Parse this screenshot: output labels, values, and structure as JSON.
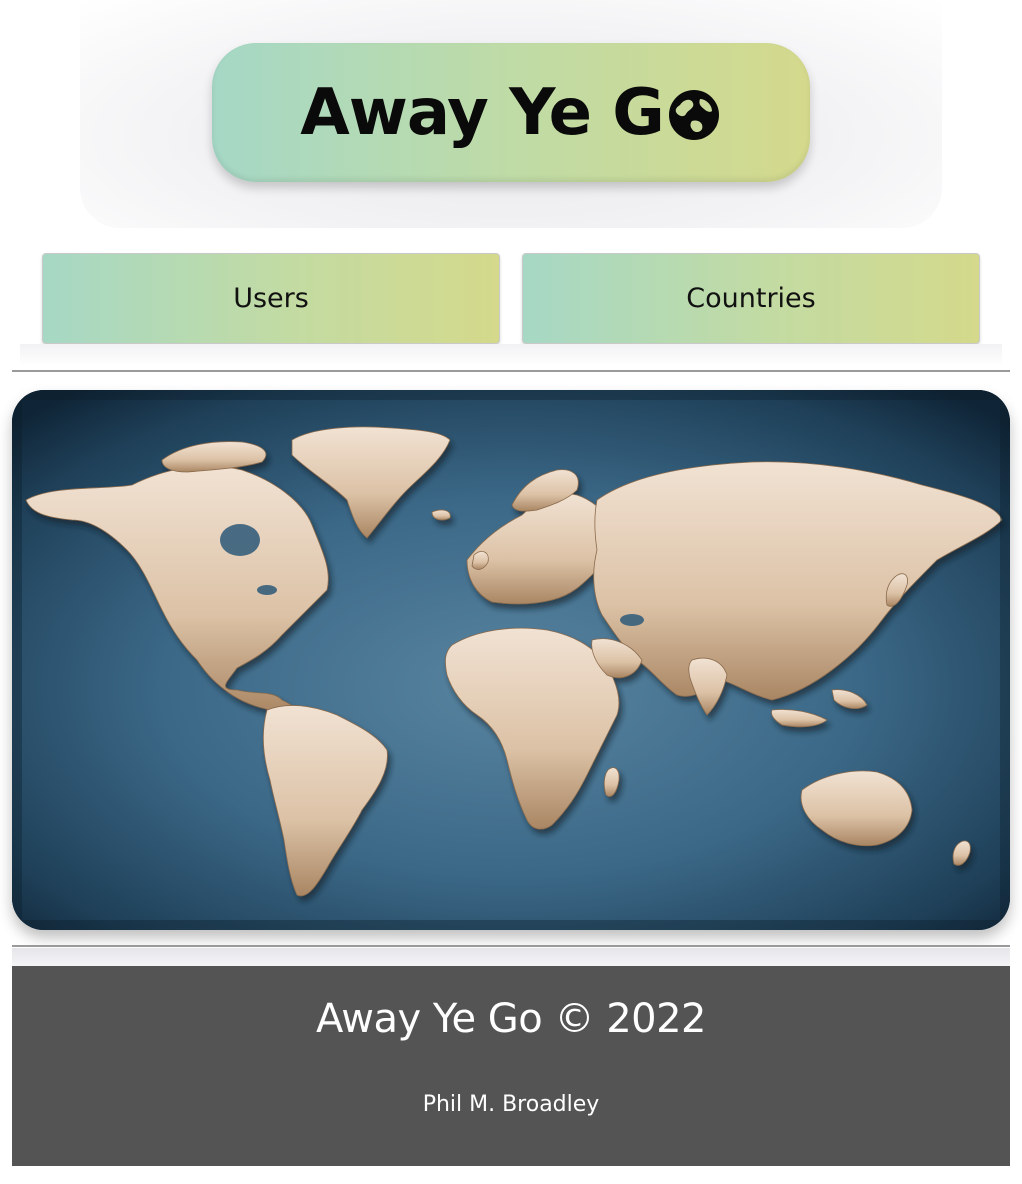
{
  "header": {
    "logo_text": "Away Ye G",
    "logo_icon": "globe-icon"
  },
  "nav": {
    "items": [
      {
        "label": "Users"
      },
      {
        "label": "Countries"
      }
    ]
  },
  "hero": {
    "image": "world-relief-map"
  },
  "footer": {
    "title": "Away Ye Go © 2022",
    "author": "Phil M. Broadley"
  },
  "colors": {
    "button_gradient_start": "#a5d8c6",
    "button_gradient_end": "#d4d98c",
    "footer_background": "#555455",
    "ocean": "#3b6887",
    "land": "#e8d6c4"
  }
}
